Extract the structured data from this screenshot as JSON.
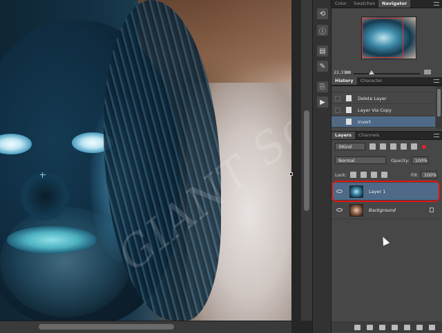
{
  "navigator_panel": {
    "tabs": [
      "Color",
      "Swatches",
      "Navigator"
    ],
    "active_tab": "Navigator",
    "zoom": "22,31%"
  },
  "history_panel": {
    "tabs": [
      "History",
      "Character"
    ],
    "items": [
      {
        "label": "Delete Layer",
        "icon": "document-icon"
      },
      {
        "label": "Layer Via Copy",
        "icon": "document-icon"
      },
      {
        "label": "Invert",
        "icon": "document-icon"
      }
    ],
    "selected_index": 2
  },
  "layers_panel": {
    "tabs": [
      "Layers",
      "Channels"
    ],
    "filter_kind": "Kind",
    "blend_mode": "Normal",
    "opacity_label": "Opacity:",
    "opacity_value": "100%",
    "lock_label": "Lock:",
    "fill_label": "Fill:",
    "fill_value": "100%",
    "layers": [
      {
        "name": "Layer 1",
        "selected": true,
        "highlighted": true
      },
      {
        "name": "Background",
        "selected": false,
        "locked": true
      }
    ]
  },
  "canvas": {
    "watermark": "GIANT Solutions",
    "horizontal_scroll": 0.15,
    "vertical_scroll": 0.35
  },
  "toolstrip": {
    "icons": [
      "history-brush-icon",
      "info-icon",
      "properties-icon",
      "brush-preset-icon",
      "clone-source-icon",
      "actions-icon"
    ]
  },
  "colors": {
    "highlight_ring": "#e01616",
    "selection": "#4e6a88",
    "navigator_box": "#e4312f"
  }
}
